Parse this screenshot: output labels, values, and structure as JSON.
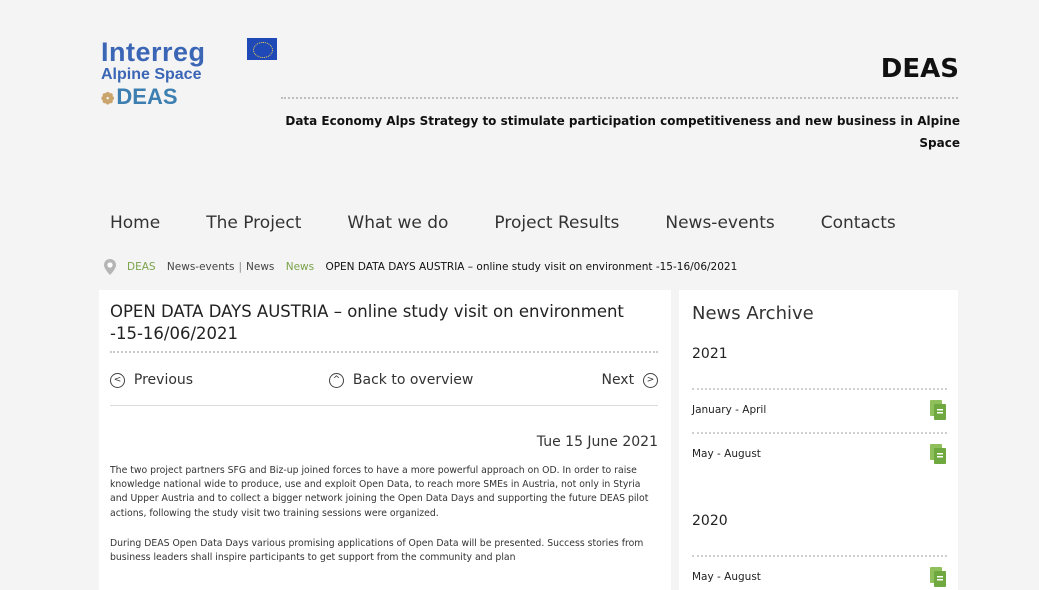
{
  "header": {
    "logo_interreg": "Interreg",
    "logo_alpine": "Alpine Space",
    "logo_deas": "DEAS",
    "site_title": "DEAS",
    "tagline": "Data Economy Alps Strategy to stimulate participation competitiveness and new business in Alpine Space"
  },
  "nav": {
    "items": [
      "Home",
      "The Project",
      "What we do",
      "Project Results",
      "News-events",
      "Contacts"
    ]
  },
  "breadcrumb": {
    "items": [
      "DEAS",
      "News-events",
      "News",
      "News"
    ],
    "current": "OPEN DATA DAYS AUSTRIA – online study visit on environment -15-16/06/2021"
  },
  "article": {
    "title": "OPEN DATA DAYS AUSTRIA – online study visit on environment -15-16/06/2021",
    "prev_label": "Previous",
    "overview_label": "Back to overview",
    "next_label": "Next",
    "date": "Tue 15 June 2021",
    "paragraphs": [
      "The two project partners SFG and Biz-up joined forces to have a more powerful approach on OD. In order to raise knowledge national wide to produce, use and exploit Open Data, to reach more SMEs in Austria, not only in Styria and Upper Austria and to collect a bigger network joining the Open Data Days and supporting the future DEAS pilot actions, following the study visit two training sessions were organized.",
      "During DEAS Open Data Days various promising applications of Open Data will be presented. Success stories from business leaders shall inspire participants to get support from the community and plan"
    ]
  },
  "sidebar": {
    "title": "News Archive",
    "years": [
      {
        "year": "2021",
        "items": [
          "January - April",
          "May - August"
        ]
      },
      {
        "year": "2020",
        "items": [
          "May - August"
        ]
      }
    ]
  },
  "colors": {
    "background": "#f4f4f4",
    "breadcrumb_green": "#7aa24a",
    "interreg_blue": "#3a66b5",
    "doc_icon_green": "#6fa83e"
  },
  "icons": {
    "breadcrumb": "location-pin-icon",
    "previous": "chevron-left-circle-icon",
    "overview": "chevron-up-circle-icon",
    "next": "chevron-right-circle-icon",
    "archive_item": "document-icon"
  }
}
